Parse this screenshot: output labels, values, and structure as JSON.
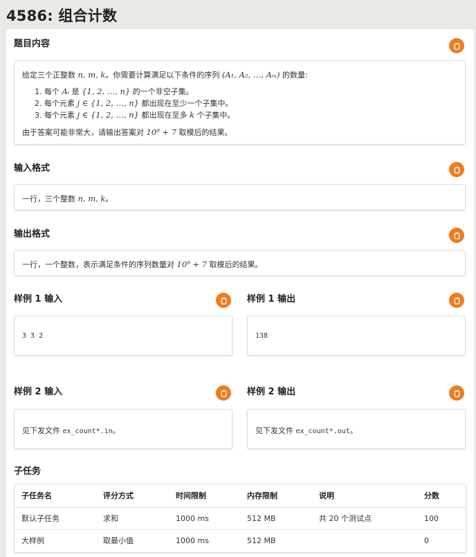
{
  "page": {
    "title": "4586: 组合计数"
  },
  "sections": {
    "statement": {
      "title": "题目内容",
      "intro_a": "给定三个正整数 ",
      "intro_math": "n, m, k",
      "intro_b": "。你需要计算满足以下条件的序列 ",
      "intro_seq": "(A₁, A₂, …, Aₘ)",
      "intro_c": " 的数量:",
      "cond1_a": "1. 每个 ",
      "cond1_math1": "Aᵢ",
      "cond1_b": " 是 ",
      "cond1_math2": "{1, 2, …, n}",
      "cond1_c": " 的一个非空子集。",
      "cond2_a": "2. 每个元素 ",
      "cond2_math": "j ∈ {1, 2, …, n}",
      "cond2_b": " 都出现在至少一个子集中。",
      "cond3_a": "3. 每个元素 ",
      "cond3_math": "j ∈ {1, 2, …, n}",
      "cond3_b": " 都出现在至多 ",
      "cond3_math2": "k",
      "cond3_c": " 个子集中。",
      "mod_a": "由于答案可能非常大，请输出答案对 ",
      "mod_math": "10⁹ + 7",
      "mod_b": " 取模后的结果。"
    },
    "input": {
      "title": "输入格式",
      "text_a": "一行，三个整数 ",
      "text_math": "n, m, k",
      "text_b": "。"
    },
    "output": {
      "title": "输出格式",
      "text_a": "一行，一个整数，表示满足条件的序列数量对 ",
      "text_math": "10⁹ + 7",
      "text_b": " 取模后的结果。"
    },
    "sample1_in": {
      "title": "样例 1 输入",
      "content": "3 3 2"
    },
    "sample1_out": {
      "title": "样例 1 输出",
      "content": "138"
    },
    "sample2_in": {
      "title": "样例 2 输入",
      "prefix": "见下发文件 ",
      "file": "ex_count*.in",
      "suffix": "。"
    },
    "sample2_out": {
      "title": "样例 2 输出",
      "prefix": "见下发文件 ",
      "file": "ex_count*.out",
      "suffix": "。"
    },
    "subtasks": {
      "title": "子任务",
      "headers": [
        "子任务名",
        "评分方式",
        "时间限制",
        "内存限制",
        "说明",
        "分数"
      ],
      "rows": [
        [
          "默认子任务",
          "求和",
          "1000 ms",
          "512 MB",
          "共 20 个测试点",
          "100"
        ],
        [
          "大样例",
          "取最小值",
          "1000 ms",
          "512 MB",
          "",
          "0"
        ]
      ]
    }
  },
  "icons": {
    "copy": "clipboard-icon"
  },
  "colors": {
    "accent": "#f07b1f",
    "background": "#ebe9e6",
    "panel": "#ffffff"
  }
}
